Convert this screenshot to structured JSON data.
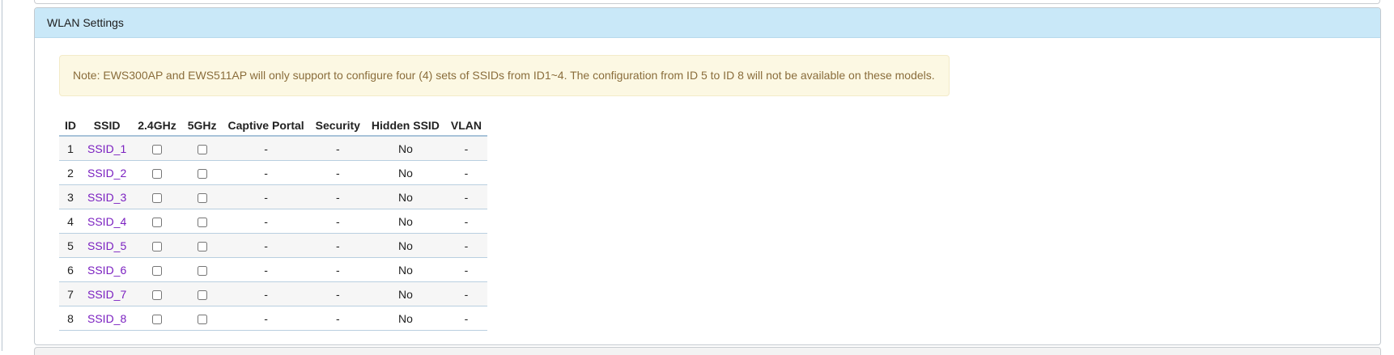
{
  "panel": {
    "title": "WLAN Settings",
    "note": "Note: EWS300AP and EWS511AP will only support to configure four (4) sets of SSIDs from ID1~4. The configuration from ID 5 to ID 8 will not be available on these models."
  },
  "table": {
    "headers": {
      "id": "ID",
      "ssid": "SSID",
      "band24": "2.4GHz",
      "band5": "5GHz",
      "captive_portal": "Captive Portal",
      "security": "Security",
      "hidden_ssid": "Hidden SSID",
      "vlan": "VLAN"
    },
    "rows": [
      {
        "id": "1",
        "ssid": "SSID_1",
        "band24_checked": false,
        "band5_checked": false,
        "captive_portal": "-",
        "security": "-",
        "hidden_ssid": "No",
        "vlan": "-"
      },
      {
        "id": "2",
        "ssid": "SSID_2",
        "band24_checked": false,
        "band5_checked": false,
        "captive_portal": "-",
        "security": "-",
        "hidden_ssid": "No",
        "vlan": "-"
      },
      {
        "id": "3",
        "ssid": "SSID_3",
        "band24_checked": false,
        "band5_checked": false,
        "captive_portal": "-",
        "security": "-",
        "hidden_ssid": "No",
        "vlan": "-"
      },
      {
        "id": "4",
        "ssid": "SSID_4",
        "band24_checked": false,
        "band5_checked": false,
        "captive_portal": "-",
        "security": "-",
        "hidden_ssid": "No",
        "vlan": "-"
      },
      {
        "id": "5",
        "ssid": "SSID_5",
        "band24_checked": false,
        "band5_checked": false,
        "captive_portal": "-",
        "security": "-",
        "hidden_ssid": "No",
        "vlan": "-"
      },
      {
        "id": "6",
        "ssid": "SSID_6",
        "band24_checked": false,
        "band5_checked": false,
        "captive_portal": "-",
        "security": "-",
        "hidden_ssid": "No",
        "vlan": "-"
      },
      {
        "id": "7",
        "ssid": "SSID_7",
        "band24_checked": false,
        "band5_checked": false,
        "captive_portal": "-",
        "security": "-",
        "hidden_ssid": "No",
        "vlan": "-"
      },
      {
        "id": "8",
        "ssid": "SSID_8",
        "band24_checked": false,
        "band5_checked": false,
        "captive_portal": "-",
        "security": "-",
        "hidden_ssid": "No",
        "vlan": "-"
      }
    ]
  },
  "colors": {
    "heading_bg": "#c9e8f8",
    "note_bg": "#fcf8e3",
    "note_text": "#8a6d3b",
    "link": "#7a1fc0",
    "row_stripe": "#f6f6f6"
  }
}
